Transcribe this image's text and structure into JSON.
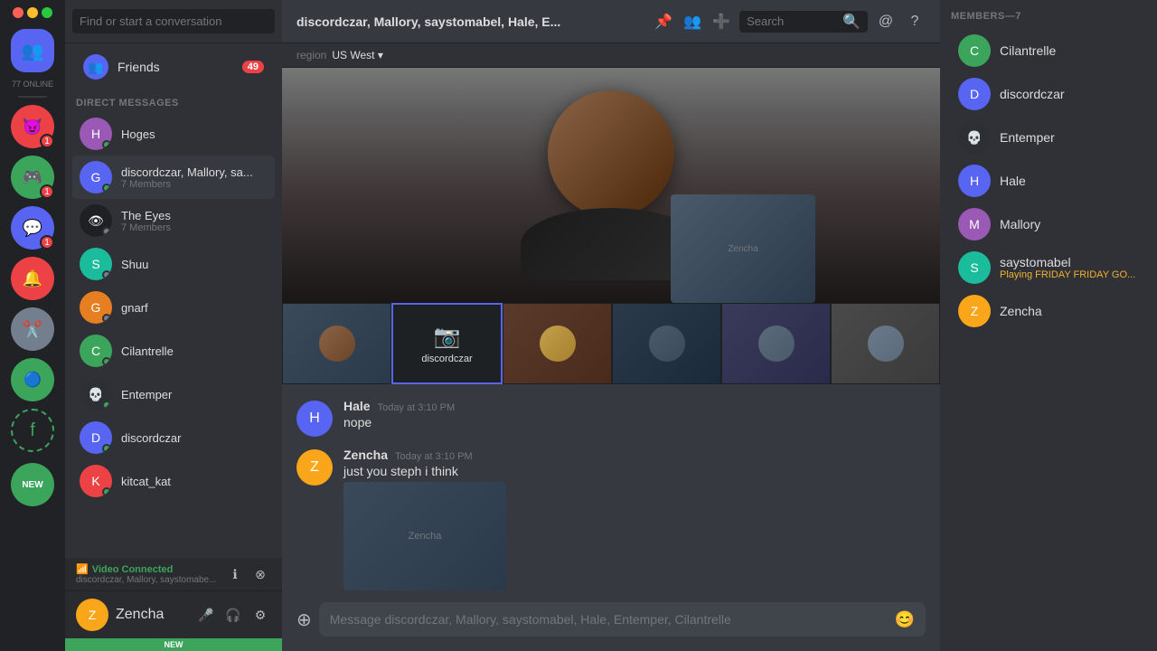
{
  "serverBar": {
    "onlineCount": "77 ONLINE",
    "newLabel": "NEW"
  },
  "sidebar": {
    "searchPlaceholder": "Find or start a conversation",
    "friendsLabel": "Friends",
    "friendsBadge": "49",
    "dmSectionLabel": "DIRECT MESSAGES",
    "dmItems": [
      {
        "id": "hoges",
        "name": "Hoges",
        "avatarColor": "av-purple",
        "initials": "H",
        "statusClass": "online"
      },
      {
        "id": "discordczar-group",
        "name": "discordczar, Mallory, sa...",
        "sub": "7 Members",
        "avatarColor": "av-blue",
        "initials": "G",
        "active": true
      },
      {
        "id": "the-eyes",
        "name": "The Eyes",
        "sub": "7 Members",
        "avatarColor": "av-dark",
        "initials": "👁"
      },
      {
        "id": "shuu",
        "name": "Shuu",
        "avatarColor": "av-teal",
        "initials": "S",
        "statusClass": "offline"
      },
      {
        "id": "gnarf",
        "name": "gnarf",
        "avatarColor": "av-orange",
        "initials": "G",
        "statusClass": "offline"
      },
      {
        "id": "cilantrelle",
        "name": "Cilantrelle",
        "avatarColor": "av-green",
        "initials": "C",
        "statusClass": "online"
      },
      {
        "id": "entemper",
        "name": "Entemper",
        "avatarColor": "av-dark",
        "initials": "💀",
        "statusClass": "online"
      },
      {
        "id": "discordczar",
        "name": "discordczar",
        "avatarColor": "av-blue",
        "initials": "D",
        "statusClass": "online"
      },
      {
        "id": "kitcat-kat",
        "name": "kitcat_kat",
        "avatarColor": "av-red",
        "initials": "K",
        "statusClass": "online"
      }
    ],
    "videoConnected": {
      "label": "Video Connected",
      "sub": "discordczar, Mallory, saystomabe..."
    },
    "currentUser": {
      "name": "Zencha",
      "avatarColor": "av-yellow",
      "initials": "Z"
    }
  },
  "header": {
    "title": "discordczar, Mallory, saystomabel, Hale, E...",
    "searchPlaceholder": "Search",
    "regionLabel": "region",
    "regionValue": "US West"
  },
  "videoCall": {
    "mainLabel": "discordczar",
    "thumbnails": [
      {
        "id": "thumb1",
        "label": "",
        "type": "person",
        "color": "#3a4a5a"
      },
      {
        "id": "thumb2",
        "label": "discordczar",
        "type": "cam-off",
        "active": true
      },
      {
        "id": "thumb3",
        "label": "",
        "type": "person",
        "color": "#5a3a2a"
      },
      {
        "id": "thumb4",
        "label": "",
        "type": "person",
        "color": "#2a3a4a"
      },
      {
        "id": "thumb5",
        "label": "",
        "type": "person",
        "color": "#3a3a5a"
      },
      {
        "id": "thumb6",
        "label": "",
        "type": "person",
        "color": "#4a4a4a"
      }
    ]
  },
  "chat": {
    "messages": [
      {
        "id": "msg1",
        "author": "Hale",
        "time": "Today at 3:10 PM",
        "text": "nope",
        "avatarColor": "av-blue",
        "initials": "H",
        "hasImage": false
      },
      {
        "id": "msg2",
        "author": "Zencha",
        "time": "Today at 3:10 PM",
        "text": "just you steph i think",
        "avatarColor": "av-yellow",
        "initials": "Z",
        "hasImage": true
      }
    ],
    "inputPlaceholder": "Message discordczar, Mallory, saystomabel, Hale, Entemper, Cilantrelle"
  },
  "members": {
    "header": "MEMBERS—7",
    "items": [
      {
        "id": "cilantrelle",
        "name": "Cilantrelle",
        "avatarColor": "av-green",
        "initials": "C",
        "sub": ""
      },
      {
        "id": "discordczar",
        "name": "discordczar",
        "avatarColor": "av-blue",
        "initials": "D",
        "sub": ""
      },
      {
        "id": "entemper",
        "name": "Entemper",
        "avatarColor": "av-dark",
        "initials": "💀",
        "sub": ""
      },
      {
        "id": "hale",
        "name": "Hale",
        "avatarColor": "av-blue",
        "initials": "H",
        "sub": ""
      },
      {
        "id": "mallory",
        "name": "Mallory",
        "avatarColor": "av-purple",
        "initials": "M",
        "sub": ""
      },
      {
        "id": "saystomabel",
        "name": "saystomabel",
        "avatarColor": "av-teal",
        "initials": "S",
        "sub": "Playing FRIDAY FRIDAY GO..."
      },
      {
        "id": "zencha",
        "name": "Zencha",
        "avatarColor": "av-yellow",
        "initials": "Z",
        "sub": ""
      }
    ]
  }
}
